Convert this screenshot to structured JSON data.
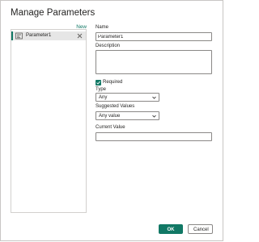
{
  "dialog": {
    "title": "Manage Parameters",
    "new_label": "New"
  },
  "parameters": [
    {
      "label": "Parameter1",
      "icon": "parameter-icon"
    }
  ],
  "form": {
    "name_label": "Name",
    "name_value": "Parameter1",
    "description_label": "Description",
    "description_value": "",
    "required_label": "Required",
    "required_checked": true,
    "type_label": "Type",
    "type_value": "Any",
    "suggested_label": "Suggested Values",
    "suggested_value": "Any value",
    "current_label": "Current Value",
    "current_value": ""
  },
  "buttons": {
    "ok": "OK",
    "cancel": "Cancel"
  },
  "colors": {
    "accent": "#117865",
    "border": "#8a8886",
    "selected_bg": "#e6e6e6"
  }
}
